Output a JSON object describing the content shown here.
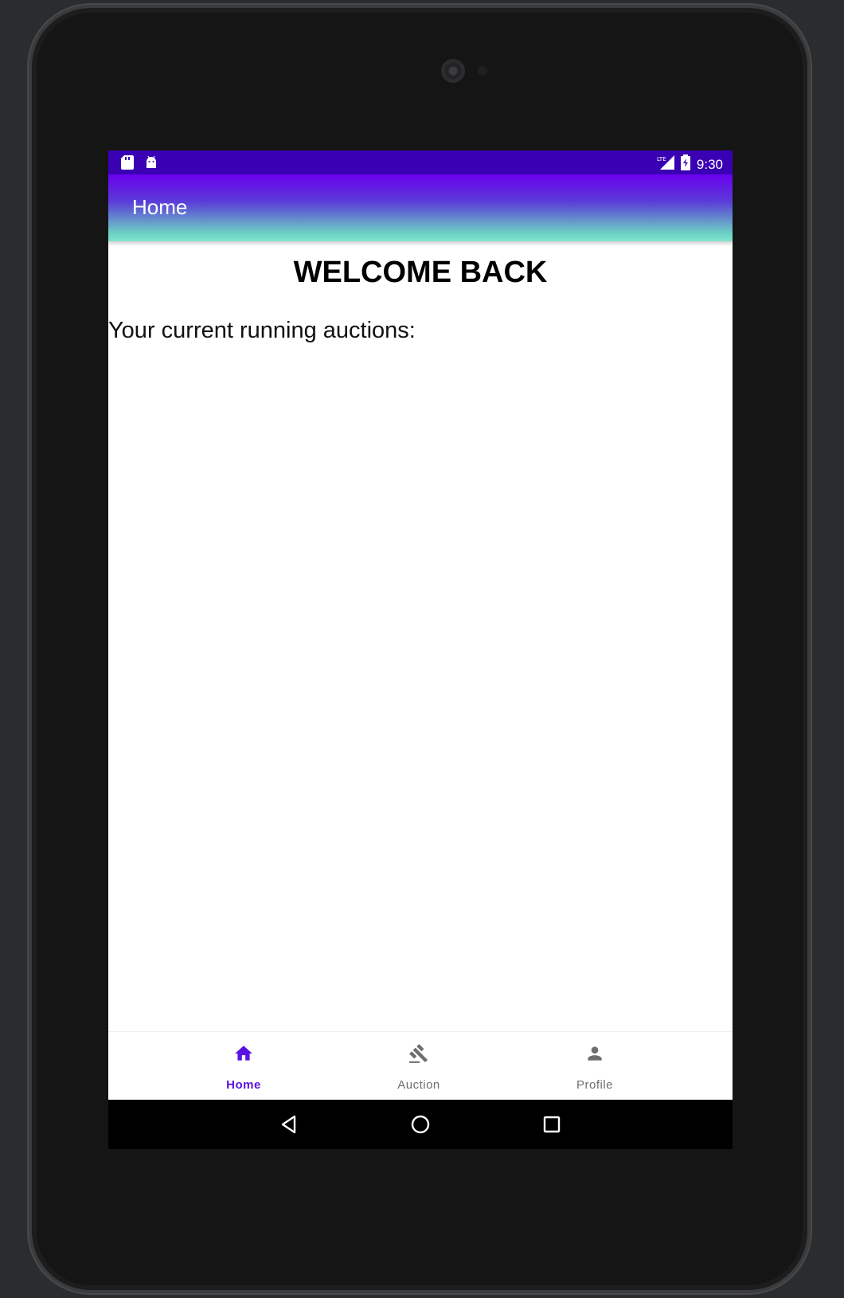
{
  "status_bar": {
    "time": "9:30",
    "left_icons": [
      "sd-card-icon",
      "android-icon"
    ],
    "right_icons": [
      "signal-icon",
      "battery-icon"
    ]
  },
  "app_bar": {
    "title": "Home"
  },
  "main": {
    "heading": "WELCOME BACK",
    "subtitle": "Your current running auctions:"
  },
  "bottom_nav": {
    "items": [
      {
        "label": "Home",
        "icon": "home-icon",
        "active": true
      },
      {
        "label": "Auction",
        "icon": "gavel-icon",
        "active": false
      },
      {
        "label": "Profile",
        "icon": "person-icon",
        "active": false
      }
    ]
  },
  "system_nav": {
    "icons": [
      "back-icon",
      "home-circle-icon",
      "recents-icon"
    ]
  },
  "colors": {
    "status_bar": "#3a00b3",
    "accent": "#5b12e0",
    "appbar_gradient_top": "#6a00ee",
    "appbar_gradient_bottom": "#7ee5cb"
  }
}
